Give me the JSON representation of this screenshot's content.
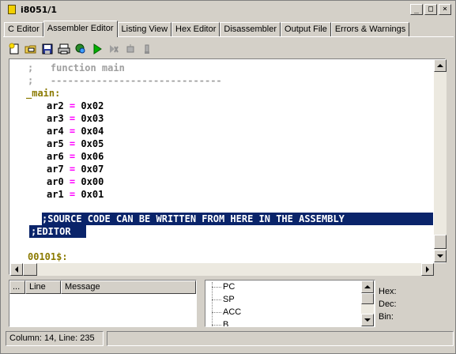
{
  "window": {
    "title": "i8051/1",
    "minimize_label": "_",
    "maximize_label": "□",
    "close_label": "×"
  },
  "tabs": [
    {
      "label": "C Editor",
      "active": false
    },
    {
      "label": "Assembler Editor",
      "active": true
    },
    {
      "label": "Listing View",
      "active": false
    },
    {
      "label": "Hex Editor",
      "active": false
    },
    {
      "label": "Disassembler",
      "active": false
    },
    {
      "label": "Output File",
      "active": false
    },
    {
      "label": "Errors & Warnings",
      "active": false
    }
  ],
  "toolbar": {
    "icons": [
      "new-file-icon",
      "open-folder-icon",
      "save-icon",
      "print-icon",
      "compile-icon",
      "run-icon",
      "step-icon",
      "breakpoint-icon",
      "debug-icon"
    ]
  },
  "editor": {
    "comment_function": ";   function main",
    "comment_rule": ";   ------------------------------",
    "label_main": "_main:",
    "assignments": [
      {
        "reg": "ar2",
        "eq": "=",
        "val": "0x02"
      },
      {
        "reg": "ar3",
        "eq": "=",
        "val": "0x03"
      },
      {
        "reg": "ar4",
        "eq": "=",
        "val": "0x04"
      },
      {
        "reg": "ar5",
        "eq": "=",
        "val": "0x05"
      },
      {
        "reg": "ar6",
        "eq": "=",
        "val": "0x06"
      },
      {
        "reg": "ar7",
        "eq": "=",
        "val": "0x07"
      },
      {
        "reg": "ar0",
        "eq": "=",
        "val": "0x00"
      },
      {
        "reg": "ar1",
        "eq": "=",
        "val": "0x01"
      }
    ],
    "selected_line_1": ";SOURCE CODE CAN BE WRITTEN FROM HERE IN THE ASSEMBLY",
    "selected_line_2": ";EDITOR",
    "label_end": "00101$:"
  },
  "messages": {
    "columns": [
      "...",
      "Line",
      "Message"
    ]
  },
  "registers": {
    "items": [
      "PC",
      "SP",
      "ACC",
      "B"
    ]
  },
  "info": {
    "hex_label": "Hex:",
    "dec_label": "Dec:",
    "bin_label": "Bin:"
  },
  "status": {
    "position": "Column: 14, Line: 235"
  },
  "colors": {
    "selection": "#0a246a",
    "label": "#8b7a00",
    "operator": "#ff00ff",
    "comment": "#a0a0a0"
  }
}
